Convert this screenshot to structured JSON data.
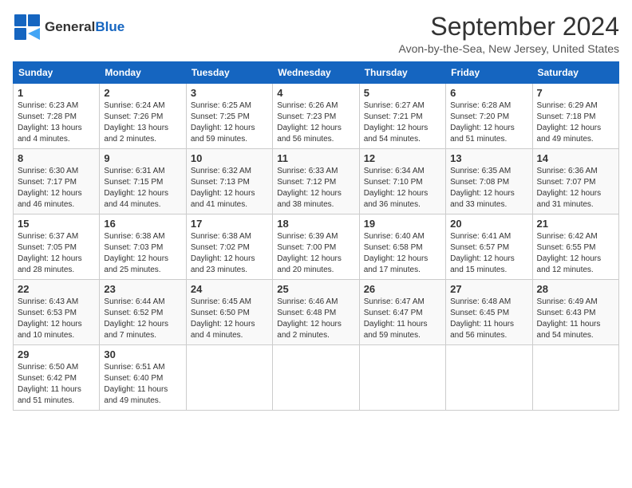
{
  "logo": {
    "line1": "General",
    "line2": "Blue"
  },
  "title": "September 2024",
  "location": "Avon-by-the-Sea, New Jersey, United States",
  "weekdays": [
    "Sunday",
    "Monday",
    "Tuesday",
    "Wednesday",
    "Thursday",
    "Friday",
    "Saturday"
  ],
  "weeks": [
    [
      {
        "day": "1",
        "info": "Sunrise: 6:23 AM\nSunset: 7:28 PM\nDaylight: 13 hours\nand 4 minutes."
      },
      {
        "day": "2",
        "info": "Sunrise: 6:24 AM\nSunset: 7:26 PM\nDaylight: 13 hours\nand 2 minutes."
      },
      {
        "day": "3",
        "info": "Sunrise: 6:25 AM\nSunset: 7:25 PM\nDaylight: 12 hours\nand 59 minutes."
      },
      {
        "day": "4",
        "info": "Sunrise: 6:26 AM\nSunset: 7:23 PM\nDaylight: 12 hours\nand 56 minutes."
      },
      {
        "day": "5",
        "info": "Sunrise: 6:27 AM\nSunset: 7:21 PM\nDaylight: 12 hours\nand 54 minutes."
      },
      {
        "day": "6",
        "info": "Sunrise: 6:28 AM\nSunset: 7:20 PM\nDaylight: 12 hours\nand 51 minutes."
      },
      {
        "day": "7",
        "info": "Sunrise: 6:29 AM\nSunset: 7:18 PM\nDaylight: 12 hours\nand 49 minutes."
      }
    ],
    [
      {
        "day": "8",
        "info": "Sunrise: 6:30 AM\nSunset: 7:17 PM\nDaylight: 12 hours\nand 46 minutes."
      },
      {
        "day": "9",
        "info": "Sunrise: 6:31 AM\nSunset: 7:15 PM\nDaylight: 12 hours\nand 44 minutes."
      },
      {
        "day": "10",
        "info": "Sunrise: 6:32 AM\nSunset: 7:13 PM\nDaylight: 12 hours\nand 41 minutes."
      },
      {
        "day": "11",
        "info": "Sunrise: 6:33 AM\nSunset: 7:12 PM\nDaylight: 12 hours\nand 38 minutes."
      },
      {
        "day": "12",
        "info": "Sunrise: 6:34 AM\nSunset: 7:10 PM\nDaylight: 12 hours\nand 36 minutes."
      },
      {
        "day": "13",
        "info": "Sunrise: 6:35 AM\nSunset: 7:08 PM\nDaylight: 12 hours\nand 33 minutes."
      },
      {
        "day": "14",
        "info": "Sunrise: 6:36 AM\nSunset: 7:07 PM\nDaylight: 12 hours\nand 31 minutes."
      }
    ],
    [
      {
        "day": "15",
        "info": "Sunrise: 6:37 AM\nSunset: 7:05 PM\nDaylight: 12 hours\nand 28 minutes."
      },
      {
        "day": "16",
        "info": "Sunrise: 6:38 AM\nSunset: 7:03 PM\nDaylight: 12 hours\nand 25 minutes."
      },
      {
        "day": "17",
        "info": "Sunrise: 6:38 AM\nSunset: 7:02 PM\nDaylight: 12 hours\nand 23 minutes."
      },
      {
        "day": "18",
        "info": "Sunrise: 6:39 AM\nSunset: 7:00 PM\nDaylight: 12 hours\nand 20 minutes."
      },
      {
        "day": "19",
        "info": "Sunrise: 6:40 AM\nSunset: 6:58 PM\nDaylight: 12 hours\nand 17 minutes."
      },
      {
        "day": "20",
        "info": "Sunrise: 6:41 AM\nSunset: 6:57 PM\nDaylight: 12 hours\nand 15 minutes."
      },
      {
        "day": "21",
        "info": "Sunrise: 6:42 AM\nSunset: 6:55 PM\nDaylight: 12 hours\nand 12 minutes."
      }
    ],
    [
      {
        "day": "22",
        "info": "Sunrise: 6:43 AM\nSunset: 6:53 PM\nDaylight: 12 hours\nand 10 minutes."
      },
      {
        "day": "23",
        "info": "Sunrise: 6:44 AM\nSunset: 6:52 PM\nDaylight: 12 hours\nand 7 minutes."
      },
      {
        "day": "24",
        "info": "Sunrise: 6:45 AM\nSunset: 6:50 PM\nDaylight: 12 hours\nand 4 minutes."
      },
      {
        "day": "25",
        "info": "Sunrise: 6:46 AM\nSunset: 6:48 PM\nDaylight: 12 hours\nand 2 minutes."
      },
      {
        "day": "26",
        "info": "Sunrise: 6:47 AM\nSunset: 6:47 PM\nDaylight: 11 hours\nand 59 minutes."
      },
      {
        "day": "27",
        "info": "Sunrise: 6:48 AM\nSunset: 6:45 PM\nDaylight: 11 hours\nand 56 minutes."
      },
      {
        "day": "28",
        "info": "Sunrise: 6:49 AM\nSunset: 6:43 PM\nDaylight: 11 hours\nand 54 minutes."
      }
    ],
    [
      {
        "day": "29",
        "info": "Sunrise: 6:50 AM\nSunset: 6:42 PM\nDaylight: 11 hours\nand 51 minutes."
      },
      {
        "day": "30",
        "info": "Sunrise: 6:51 AM\nSunset: 6:40 PM\nDaylight: 11 hours\nand 49 minutes."
      },
      {
        "day": "",
        "info": ""
      },
      {
        "day": "",
        "info": ""
      },
      {
        "day": "",
        "info": ""
      },
      {
        "day": "",
        "info": ""
      },
      {
        "day": "",
        "info": ""
      }
    ]
  ]
}
